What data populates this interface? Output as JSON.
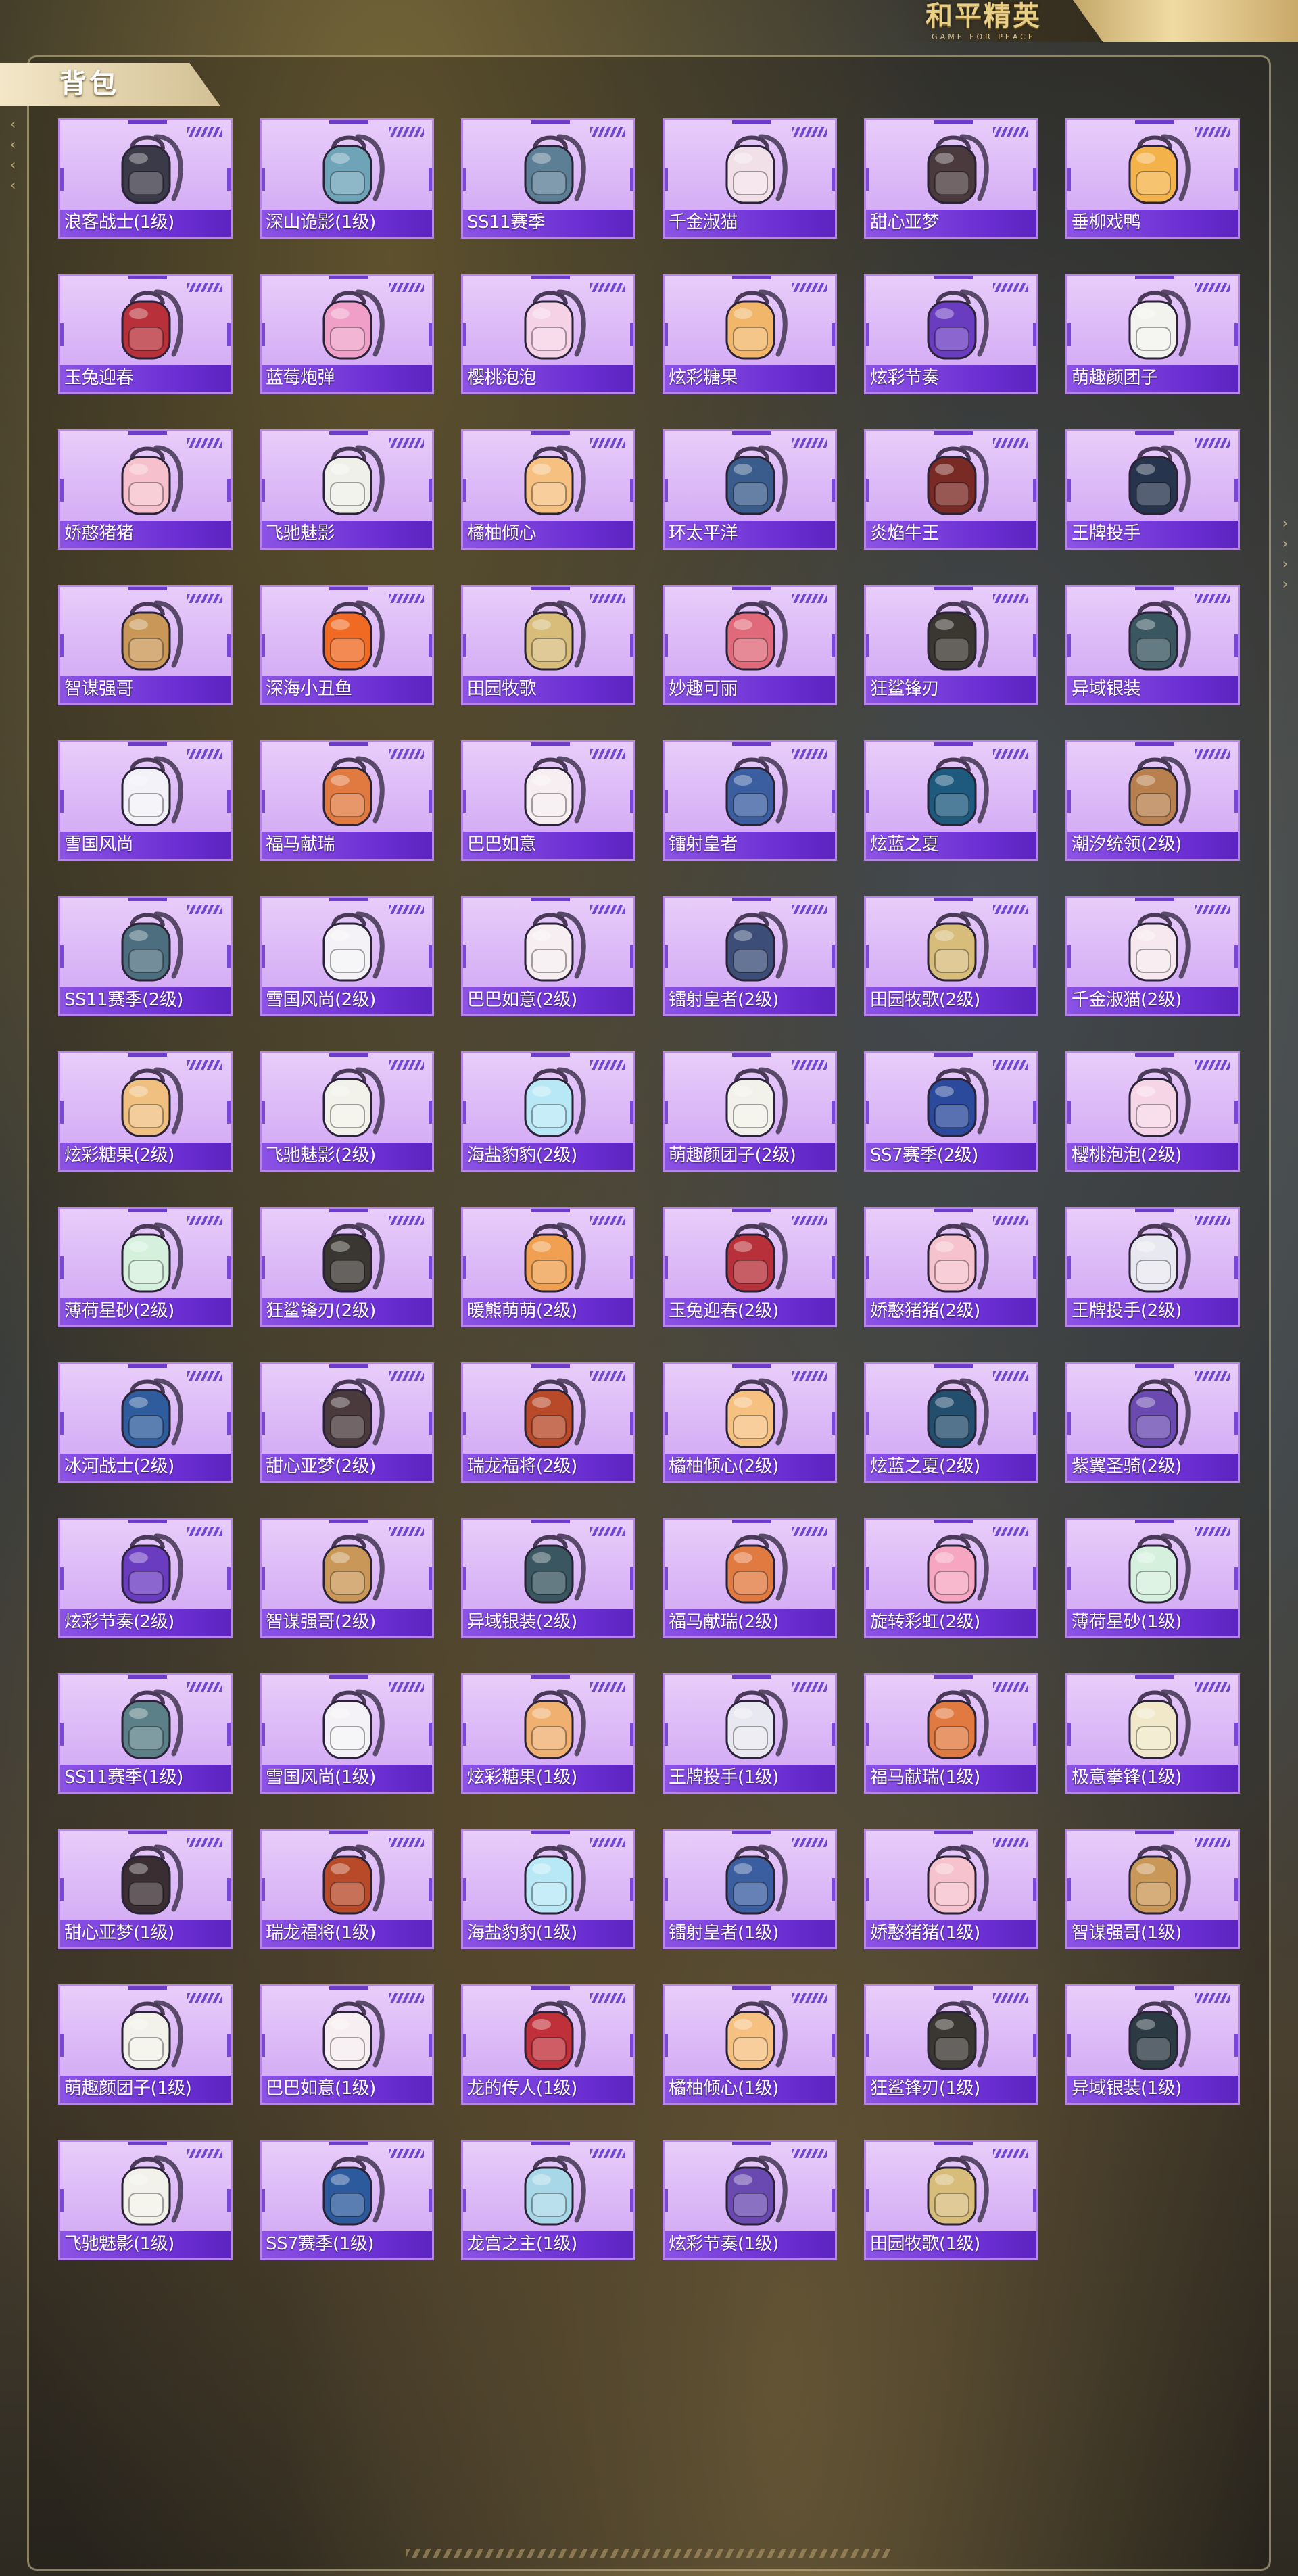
{
  "logo": {
    "main": "和平精英",
    "sub": "GAME FOR PEACE"
  },
  "panel": {
    "title": "背包"
  },
  "accent": {
    "card_bg": "#d9b4f6",
    "label_bar": "#6a2ed2",
    "gold": "#e9cf86"
  },
  "items": [
    {
      "name": "浪客战士(1级)",
      "icon": "backpack-icon",
      "color": "#3b3a48"
    },
    {
      "name": "深山诡影(1级)",
      "icon": "backpack-icon",
      "color": "#6fa3b8"
    },
    {
      "name": "SS11赛季",
      "icon": "backpack-icon",
      "color": "#5c7f96"
    },
    {
      "name": "千金淑猫",
      "icon": "backpack-icon",
      "color": "#f2e0e8"
    },
    {
      "name": "甜心亚梦",
      "icon": "backpack-icon",
      "color": "#4a3a3e"
    },
    {
      "name": "垂柳戏鸭",
      "icon": "backpack-icon",
      "color": "#f4b24a"
    },
    {
      "name": "玉兔迎春",
      "icon": "backpack-icon",
      "color": "#b8303a"
    },
    {
      "name": "蓝莓炮弹",
      "icon": "backpack-icon",
      "color": "#f0a0c8"
    },
    {
      "name": "樱桃泡泡",
      "icon": "backpack-icon",
      "color": "#f6d2e6"
    },
    {
      "name": "炫彩糖果",
      "icon": "backpack-icon",
      "color": "#f2b66a"
    },
    {
      "name": "炫彩节奏",
      "icon": "backpack-icon",
      "color": "#6a3cc0"
    },
    {
      "name": "萌趣颜团子",
      "icon": "backpack-icon",
      "color": "#f2f2ee"
    },
    {
      "name": "娇憨猪猪",
      "icon": "backpack-icon",
      "color": "#f6c0cc"
    },
    {
      "name": "飞驰魅影",
      "icon": "backpack-icon",
      "color": "#f0f0ea"
    },
    {
      "name": "橘柚倾心",
      "icon": "backpack-icon",
      "color": "#f6c080"
    },
    {
      "name": "环太平洋",
      "icon": "backpack-icon",
      "color": "#3a5c8c"
    },
    {
      "name": "炎焰牛王",
      "icon": "backpack-icon",
      "color": "#7a2a24"
    },
    {
      "name": "王牌投手",
      "icon": "backpack-icon",
      "color": "#26344e"
    },
    {
      "name": "智谋强哥",
      "icon": "backpack-icon",
      "color": "#c99858"
    },
    {
      "name": "深海小丑鱼",
      "icon": "backpack-icon",
      "color": "#f06a24"
    },
    {
      "name": "田园牧歌",
      "icon": "backpack-icon",
      "color": "#d8bc7a"
    },
    {
      "name": "妙趣可丽",
      "icon": "backpack-icon",
      "color": "#e06a7a"
    },
    {
      "name": "狂鲨锋刃",
      "icon": "backpack-icon",
      "color": "#3a3630"
    },
    {
      "name": "异域银装",
      "icon": "backpack-icon",
      "color": "#3a5660"
    },
    {
      "name": "雪国风尚",
      "icon": "backpack-icon",
      "color": "#f2f2f8"
    },
    {
      "name": "福马献瑞",
      "icon": "backpack-icon",
      "color": "#e07a40"
    },
    {
      "name": "巴巴如意",
      "icon": "backpack-icon",
      "color": "#f6eef0"
    },
    {
      "name": "镭射皇者",
      "icon": "backpack-icon",
      "color": "#3a5ea0"
    },
    {
      "name": "炫蓝之夏",
      "icon": "backpack-icon",
      "color": "#1e5a7e"
    },
    {
      "name": "潮汐统领(2级)",
      "icon": "backpack-icon",
      "color": "#b8804e"
    },
    {
      "name": "SS11赛季(2级)",
      "icon": "backpack-icon",
      "color": "#4c6e7e"
    },
    {
      "name": "雪国风尚(2级)",
      "icon": "backpack-icon",
      "color": "#f4f2f6"
    },
    {
      "name": "巴巴如意(2级)",
      "icon": "backpack-icon",
      "color": "#f6eef0"
    },
    {
      "name": "镭射皇者(2级)",
      "icon": "backpack-icon",
      "color": "#3c4e78"
    },
    {
      "name": "田园牧歌(2级)",
      "icon": "backpack-icon",
      "color": "#d8bc7a"
    },
    {
      "name": "千金淑猫(2级)",
      "icon": "backpack-icon",
      "color": "#f6e8ee"
    },
    {
      "name": "炫彩糖果(2级)",
      "icon": "backpack-icon",
      "color": "#f0c080"
    },
    {
      "name": "飞驰魅影(2级)",
      "icon": "backpack-icon",
      "color": "#f2f2ea"
    },
    {
      "name": "海盐豹豹(2级)",
      "icon": "backpack-icon",
      "color": "#b8e8f6"
    },
    {
      "name": "萌趣颜团子(2级)",
      "icon": "backpack-icon",
      "color": "#f2f2ea"
    },
    {
      "name": "SS7赛季(2级)",
      "icon": "backpack-icon",
      "color": "#2c4a9c"
    },
    {
      "name": "樱桃泡泡(2级)",
      "icon": "backpack-icon",
      "color": "#f6d6e6"
    },
    {
      "name": "薄荷星砂(2级)",
      "icon": "backpack-icon",
      "color": "#d6f0de"
    },
    {
      "name": "狂鲨锋刃(2级)",
      "icon": "backpack-icon",
      "color": "#3a3632"
    },
    {
      "name": "暖熊萌萌(2级)",
      "icon": "backpack-icon",
      "color": "#f0a050"
    },
    {
      "name": "玉兔迎春(2级)",
      "icon": "backpack-icon",
      "color": "#b8303a"
    },
    {
      "name": "娇憨猪猪(2级)",
      "icon": "backpack-icon",
      "color": "#f6c2ce"
    },
    {
      "name": "王牌投手(2级)",
      "icon": "backpack-icon",
      "color": "#e8e8f0"
    },
    {
      "name": "冰河战士(2级)",
      "icon": "backpack-icon",
      "color": "#2e5c9c"
    },
    {
      "name": "甜心亚梦(2级)",
      "icon": "backpack-icon",
      "color": "#4a3a3e"
    },
    {
      "name": "瑞龙福将(2级)",
      "icon": "backpack-icon",
      "color": "#b84a2a"
    },
    {
      "name": "橘柚倾心(2级)",
      "icon": "backpack-icon",
      "color": "#f6c080"
    },
    {
      "name": "炫蓝之夏(2级)",
      "icon": "backpack-icon",
      "color": "#244e6e"
    },
    {
      "name": "紫翼圣骑(2级)",
      "icon": "backpack-icon",
      "color": "#6a4ab0"
    },
    {
      "name": "炫彩节奏(2级)",
      "icon": "backpack-icon",
      "color": "#6a3cc0"
    },
    {
      "name": "智谋强哥(2级)",
      "icon": "backpack-icon",
      "color": "#c99858"
    },
    {
      "name": "异域银装(2级)",
      "icon": "backpack-icon",
      "color": "#3a5660"
    },
    {
      "name": "福马献瑞(2级)",
      "icon": "backpack-icon",
      "color": "#e07a40"
    },
    {
      "name": "旋转彩虹(2级)",
      "icon": "backpack-icon",
      "color": "#f6a6c0"
    },
    {
      "name": "薄荷星砂(1级)",
      "icon": "backpack-icon",
      "color": "#d6f0de"
    },
    {
      "name": "SS11赛季(1级)",
      "icon": "backpack-icon",
      "color": "#5c8088"
    },
    {
      "name": "雪国风尚(1级)",
      "icon": "backpack-icon",
      "color": "#f4f2f6"
    },
    {
      "name": "炫彩糖果(1级)",
      "icon": "backpack-icon",
      "color": "#f0b070"
    },
    {
      "name": "王牌投手(1级)",
      "icon": "backpack-icon",
      "color": "#e8e8f0"
    },
    {
      "name": "福马献瑞(1级)",
      "icon": "backpack-icon",
      "color": "#e07a40"
    },
    {
      "name": "极意拳锋(1级)",
      "icon": "backpack-icon",
      "color": "#f0e8c8"
    },
    {
      "name": "甜心亚梦(1级)",
      "icon": "backpack-icon",
      "color": "#3a2e32"
    },
    {
      "name": "瑞龙福将(1级)",
      "icon": "backpack-icon",
      "color": "#b84a2a"
    },
    {
      "name": "海盐豹豹(1级)",
      "icon": "backpack-icon",
      "color": "#b8e8f6"
    },
    {
      "name": "镭射皇者(1级)",
      "icon": "backpack-icon",
      "color": "#3a5ea0"
    },
    {
      "name": "娇憨猪猪(1级)",
      "icon": "backpack-icon",
      "color": "#f6c2ce"
    },
    {
      "name": "智谋强哥(1级)",
      "icon": "backpack-icon",
      "color": "#c99858"
    },
    {
      "name": "萌趣颜团子(1级)",
      "icon": "backpack-icon",
      "color": "#f2f2ea"
    },
    {
      "name": "巴巴如意(1级)",
      "icon": "backpack-icon",
      "color": "#f6eef0"
    },
    {
      "name": "龙的传人(1级)",
      "icon": "backpack-icon",
      "color": "#c0303a"
    },
    {
      "name": "橘柚倾心(1级)",
      "icon": "backpack-icon",
      "color": "#f6c080"
    },
    {
      "name": "狂鲨锋刃(1级)",
      "icon": "backpack-icon",
      "color": "#3a3632"
    },
    {
      "name": "异域银装(1级)",
      "icon": "backpack-icon",
      "color": "#2c3a44"
    },
    {
      "name": "飞驰魅影(1级)",
      "icon": "backpack-icon",
      "color": "#f2f2ea"
    },
    {
      "name": "SS7赛季(1级)",
      "icon": "backpack-icon",
      "color": "#2c5a9c"
    },
    {
      "name": "龙宫之主(1级)",
      "icon": "backpack-icon",
      "color": "#a8d8e8"
    },
    {
      "name": "炫彩节奏(1级)",
      "icon": "backpack-icon",
      "color": "#6a4ab0"
    },
    {
      "name": "田园牧歌(1级)",
      "icon": "backpack-icon",
      "color": "#d8bc7a"
    }
  ]
}
